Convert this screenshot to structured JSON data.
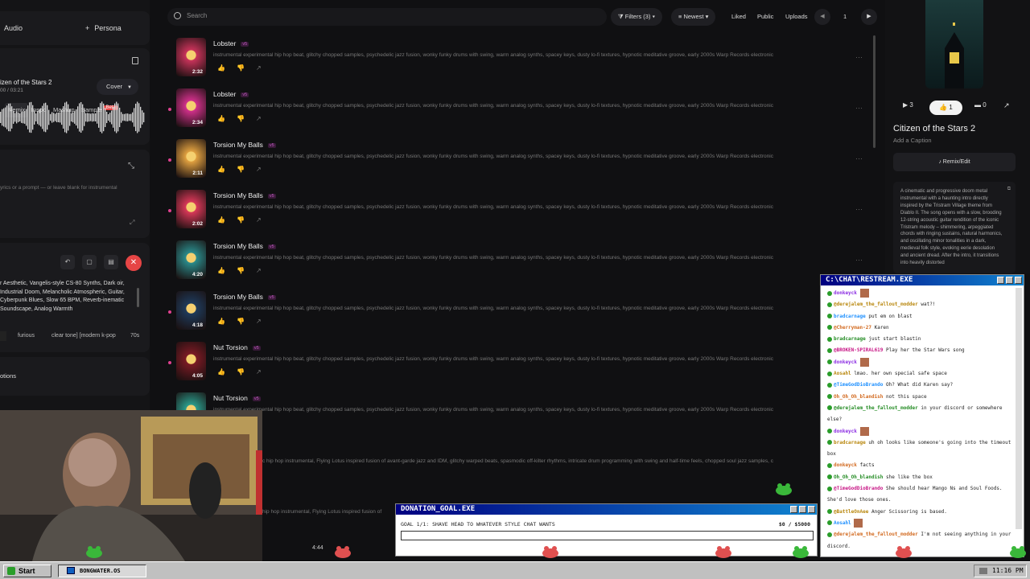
{
  "left": {
    "mode_audio": "Audio",
    "mode_persona": "Persona",
    "segments": [
      "Remix",
      "Inspo",
      "Mashup",
      "Sample"
    ],
    "beta_badge": "Beta",
    "song_title": "izen of the Stars 2",
    "song_time": "00 / 03:21",
    "cover_label": "Cover",
    "lyrics_placeholder": "yrics or a prompt — or leave blank for instrumental",
    "style_text": "r Aesthetic, Vangelis-style CS-80 Synths, Dark oir, Industrial Doom, Melancholic Atmospheric, Guitar, Cyberpunk Blues, Slow 65 BPM, Reverb-inematic Soundscape, Analog Warmth",
    "tags": [
      "furious",
      "clear tone] [modern k-pop",
      "70s"
    ],
    "options_label": "otions"
  },
  "topbar": {
    "search_placeholder": "Search",
    "filters": "Filters (3)",
    "sort": "Newest",
    "liked": "Liked",
    "public": "Public",
    "uploads": "Uploads",
    "page": "1"
  },
  "songs": [
    {
      "title": "Lobster",
      "version": "v5",
      "duration": "2:32",
      "desc": "instrumental experimental hip hop beat, glitchy chopped samples, psychedelic jazz fusion, wonky funky drums with swing, warm analog synths, spacey keys, dusty lo-fi textures, hypnotic meditative groove, early 2000s Warp Records electronic",
      "thumb": "#c8335a",
      "dot": false
    },
    {
      "title": "Lobster",
      "version": "v5",
      "duration": "2:34",
      "desc": "instrumental experimental hip hop beat, glitchy chopped samples, psychedelic jazz fusion, wonky funky drums with swing, warm analog synths, spacey keys, dusty lo-fi textures, hypnotic meditative groove, early 2000s Warp Records electronic",
      "thumb": "#d0308a",
      "dot": true
    },
    {
      "title": "Torsion My Balls",
      "version": "v5",
      "duration": "2:11",
      "desc": "instrumental experimental hip hop beat, glitchy chopped samples, psychedelic jazz fusion, wonky funky drums with swing, warm analog synths, spacey keys, dusty lo-fi textures, hypnotic meditative groove, early 2000s Warp Records electronic",
      "thumb": "#e0a040",
      "dot": true
    },
    {
      "title": "Torsion My Balls",
      "version": "v5",
      "duration": "2:02",
      "desc": "instrumental experimental hip hop beat, glitchy chopped samples, psychedelic jazz fusion, wonky funky drums with swing, warm analog synths, spacey keys, dusty lo-fi textures, hypnotic meditative groove, early 2000s Warp Records electronic",
      "thumb": "#d83858",
      "dot": true
    },
    {
      "title": "Torsion My Balls",
      "version": "v5",
      "duration": "4:20",
      "desc": "instrumental experimental hip hop beat, glitchy chopped samples, psychedelic jazz fusion, wonky funky drums with swing, warm analog synths, spacey keys, dusty lo-fi textures, hypnotic meditative groove, early 2000s Warp Records electronic",
      "thumb": "#2a8a8a",
      "dot": false
    },
    {
      "title": "Torsion My Balls",
      "version": "v5",
      "duration": "4:18",
      "desc": "instrumental experimental hip hop beat, glitchy chopped samples, psychedelic jazz fusion, wonky funky drums with swing, warm analog synths, spacey keys, dusty lo-fi textures, hypnotic meditative groove, early 2000s Warp Records electronic",
      "thumb": "#1e3a5a",
      "dot": true
    },
    {
      "title": "Nut Torsion",
      "version": "v5",
      "duration": "4:05",
      "desc": "instrumental experimental hip hop beat, glitchy chopped samples, psychedelic jazz fusion, wonky funky drums with swing, warm analog synths, spacey keys, dusty lo-fi textures, hypnotic meditative groove, early 2000s Warp Records electronic",
      "thumb": "#7a1a24",
      "dot": true
    },
    {
      "title": "Nut Torsion",
      "version": "v5",
      "duration": "",
      "desc": "instrumental experimental hip hop beat, glitchy chopped samples, psychedelic jazz fusion, wonky funky drums with swing, warm analog synths, spacey keys, dusty lo-fi textures, hypnotic meditative groove, early 2000s Warp Records electronic",
      "thumb": "#2a9a8a",
      "dot": false
    }
  ],
  "extra_desc_1": "c hip hop instrumental, Flying Lotus inspired fusion of avant-garde jazz and IDM, glitchy warped beats, spasmodic off-kilter rhythms, intricate drum programming with swing and half-time feels, chopped soul jazz samples, c",
  "extra_desc_2": "hip hop instrumental, Flying Lotus inspired fusion of",
  "right": {
    "plays": "3",
    "likes": "1",
    "comments": "0",
    "title": "Citizen of the Stars 2",
    "caption": "Add a Caption",
    "remix_button": "Remix/Edit",
    "description": "A cinematic and progressive doom metal instrumental with a haunting intro directly inspired by the Tristram Village theme from Diablo II. The song opens with a slow, brooding 12-string acoustic guitar rendition of the iconic Tristram melody – shimmering, arpeggiated chords with ringing sustains, natural harmonics, and oscillating minor tonalities in a dark, medieval folk style, evoking eerie desolation and ancient dread. After the intro, it transitions into heavily distorted"
  },
  "chat": {
    "title": "C:\\CHAT\\RESTREAM.EXE",
    "messages": [
      {
        "user": "donkeyck",
        "text": "",
        "emote": true
      },
      {
        "user": "@derejalem_the_fallout_modder",
        "text": "wat?!",
        "emote": false
      },
      {
        "user": "bradcarnage",
        "text": "put em on blast",
        "emote": false
      },
      {
        "user": "@Cherryman-27",
        "text": "Karen",
        "emote": false
      },
      {
        "user": "bradcarnage",
        "text": "just start blastin",
        "emote": false
      },
      {
        "user": "@BROKEN-SPIRAL619",
        "text": "Play her the Star Wars song",
        "emote": false
      },
      {
        "user": "donkeyck",
        "text": "",
        "emote": true
      },
      {
        "user": "Aosahl",
        "text": "lmao. her own special safe space",
        "emote": false
      },
      {
        "user": "@TimeGodDioBrando",
        "text": "Oh? What did Karen say?",
        "emote": false
      },
      {
        "user": "Oh_Oh_Oh_blandish",
        "text": "not this space",
        "emote": false
      },
      {
        "user": "@derejalem_the_fallout_modder",
        "text": "in your discord or somewhere",
        "emote": false
      },
      {
        "user": "",
        "text": "else?",
        "emote": false
      },
      {
        "user": "donkeyck",
        "text": "",
        "emote": true
      },
      {
        "user": "bradcarnage",
        "text": "uh oh looks like someone's going into the timeout",
        "emote": false
      },
      {
        "user": "",
        "text": "box",
        "emote": false
      },
      {
        "user": "donkeyck",
        "text": "facts",
        "emote": false
      },
      {
        "user": "Oh_Oh_Oh_blandish",
        "text": "she like the box",
        "emote": false
      },
      {
        "user": "@TimeGodDioBrando",
        "text": "She should hear Mango Ns and Soul Foods.",
        "emote": false
      },
      {
        "user": "",
        "text": "She'd love those ones.",
        "emote": false
      },
      {
        "user": "@BattleOnAee",
        "text": "Anger Scissoring is based.",
        "emote": false
      },
      {
        "user": "Aosahl",
        "text": "",
        "emote": true
      },
      {
        "user": "@derejalem_the_fallout_modder",
        "text": "I'm not seeing anything in your",
        "emote": false
      },
      {
        "user": "",
        "text": "discord.",
        "emote": false
      }
    ]
  },
  "donation": {
    "title": "DONATION_GOAL.EXE",
    "goal_text": "GOAL 1/1: SHAVE HEAD TO WHATEVER STYLE CHAT WANTS",
    "progress_text": "$0 / $5000",
    "progress": 0
  },
  "player": {
    "time": "4:44"
  },
  "taskbar": {
    "start": "Start",
    "item": "BONGWATER.OS",
    "clock": "11:16 PM"
  },
  "colors": {
    "accent": "#e64545",
    "title_bar": "#000080",
    "version_pink": "#c05cc0"
  }
}
